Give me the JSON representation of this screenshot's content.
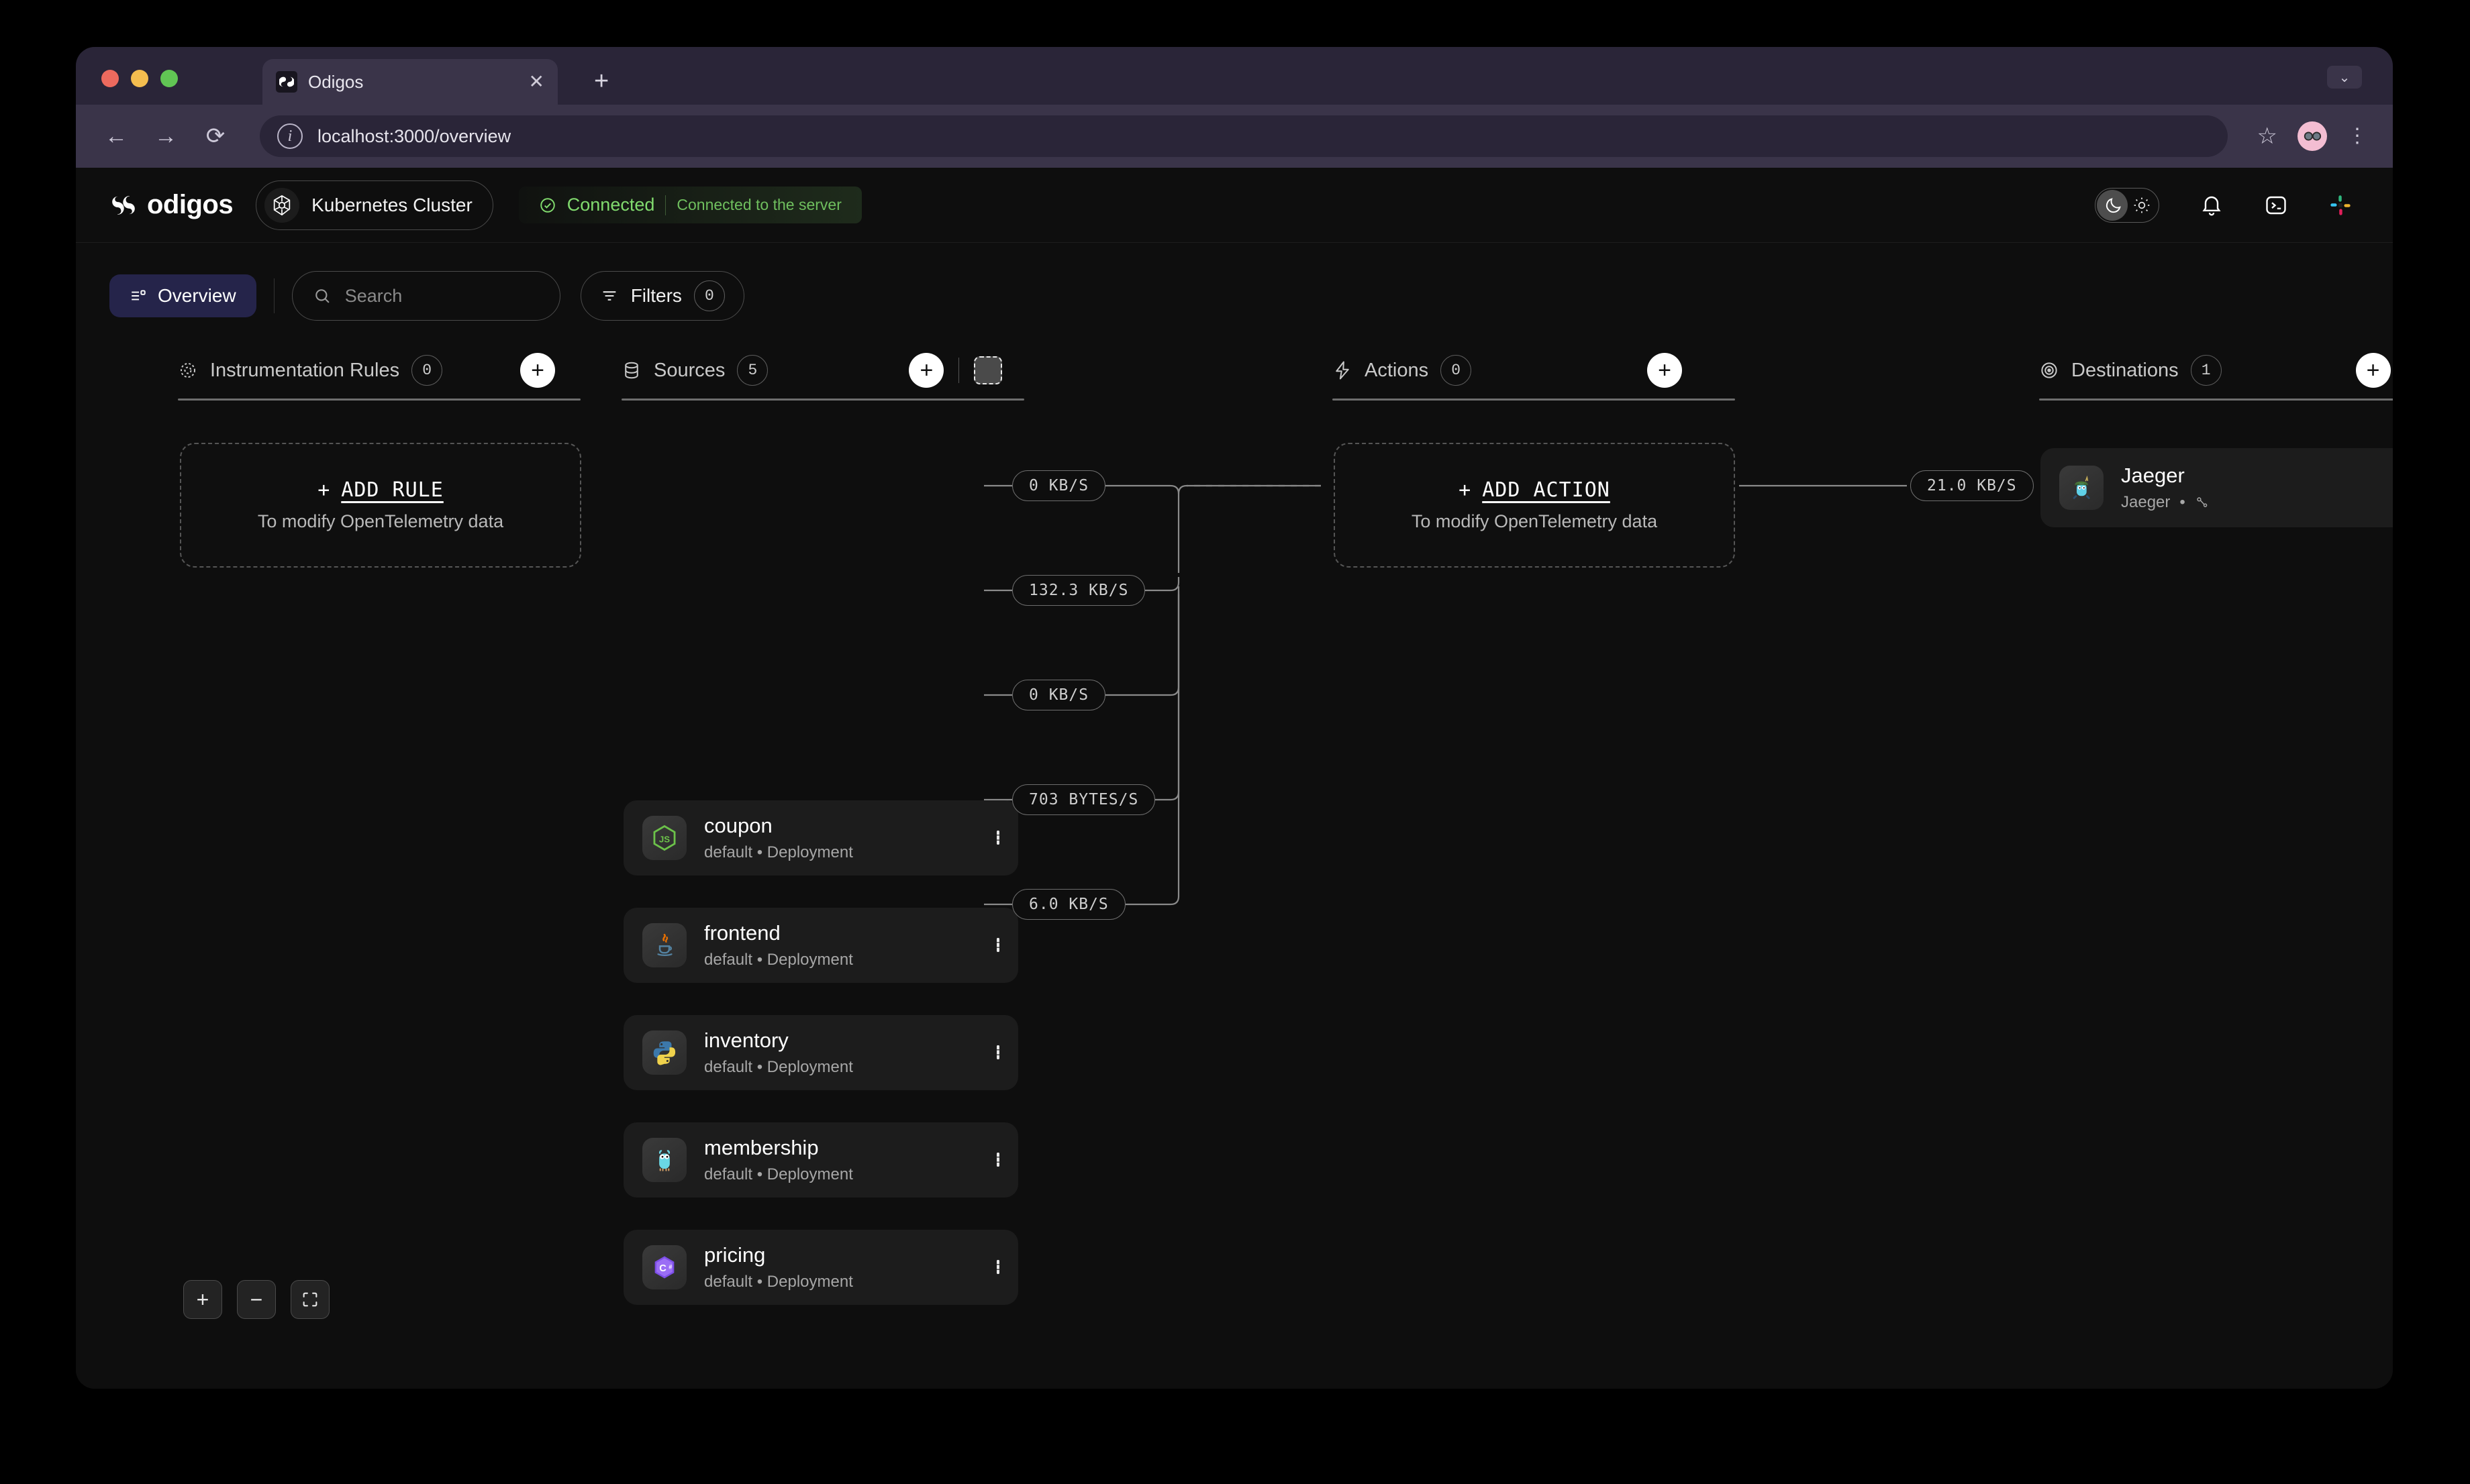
{
  "browser": {
    "tab": {
      "title": "Odigos",
      "favicon_icon": "odigos-favicon",
      "close_icon": "close-icon"
    },
    "new_tab_icon": "plus-icon",
    "tab_list_chevron_icon": "chevron-down-icon",
    "back_icon": "arrow-left-icon",
    "forward_icon": "arrow-right-icon",
    "reload_icon": "reload-icon",
    "site_info_icon": "info-icon",
    "url": "localhost:3000/overview",
    "bookmark_icon": "star-icon",
    "profile_icon": "avatar-sunglasses",
    "menu_icon": "kebab-menu-icon"
  },
  "header": {
    "brand": "odigos",
    "brand_icon": "odigos-logo",
    "cluster_icon": "kubernetes-icon",
    "cluster_label": "Kubernetes Cluster",
    "status_icon": "check-circle-icon",
    "status_main": "Connected",
    "status_detail": "Connected to the server",
    "status_color": "#81db6e",
    "theme_toggle": {
      "dark_icon": "moon-icon",
      "light_icon": "sun-icon",
      "active": "dark"
    },
    "notifications_icon": "bell-icon",
    "terminal_icon": "terminal-icon",
    "slack_icon": "slack-icon"
  },
  "toolbar": {
    "overview_label": "Overview",
    "overview_icon": "list-icon",
    "overview_accent": "#25244a",
    "search": {
      "placeholder": "Search",
      "value": "",
      "icon": "search-icon"
    },
    "filters": {
      "label": "Filters",
      "count": "0",
      "icon": "filter-icon"
    }
  },
  "columns": [
    {
      "key": "rules",
      "icon": "gear-dots-icon",
      "title": "Instrumentation Rules",
      "count": "0",
      "add_icon": "plus-icon"
    },
    {
      "key": "sources",
      "icon": "database-icon",
      "title": "Sources",
      "count": "5",
      "add_icon": "plus-icon",
      "select_icon": "dashed-select-icon"
    },
    {
      "key": "actions",
      "icon": "lightning-icon",
      "title": "Actions",
      "count": "0",
      "add_icon": "plus-icon"
    },
    {
      "key": "destinations",
      "icon": "target-icon",
      "title": "Destinations",
      "count": "1",
      "add_icon": "plus-icon"
    }
  ],
  "add_rule_card": {
    "plus": "+",
    "title": "ADD RULE",
    "subtitle": "To modify OpenTelemetry data"
  },
  "add_action_card": {
    "plus": "+",
    "title": "ADD ACTION",
    "subtitle": "To modify OpenTelemetry data"
  },
  "sources": [
    {
      "name": "coupon",
      "meta": "default • Deployment",
      "language_icon": "nodejs-icon",
      "throughput": "0 KB/S",
      "select_icon": "dashed-select-icon"
    },
    {
      "name": "frontend",
      "meta": "default • Deployment",
      "language_icon": "java-icon",
      "throughput": "132.3 KB/S",
      "select_icon": "dashed-select-icon"
    },
    {
      "name": "inventory",
      "meta": "default • Deployment",
      "language_icon": "python-icon",
      "throughput": "0 KB/S",
      "select_icon": "dashed-select-icon"
    },
    {
      "name": "membership",
      "meta": "default • Deployment",
      "language_icon": "golang-icon",
      "throughput": "703 BYTES/S",
      "select_icon": "dashed-select-icon"
    },
    {
      "name": "pricing",
      "meta": "default • Deployment",
      "language_icon": "csharp-icon",
      "throughput": "6.0 KB/S",
      "select_icon": "dashed-select-icon"
    }
  ],
  "destinations": [
    {
      "name": "Jaeger",
      "meta": "Jaeger",
      "separator": "•",
      "signal_icon": "traces-icon",
      "vendor_icon": "jaeger-icon",
      "throughput": "21.0 KB/S"
    }
  ],
  "zoom_controls": [
    {
      "name": "zoom-in",
      "icon": "plus-icon",
      "label": "+"
    },
    {
      "name": "zoom-out",
      "icon": "minus-icon",
      "label": "−"
    },
    {
      "name": "fit-view",
      "icon": "fit-screen-icon",
      "label": ""
    }
  ]
}
